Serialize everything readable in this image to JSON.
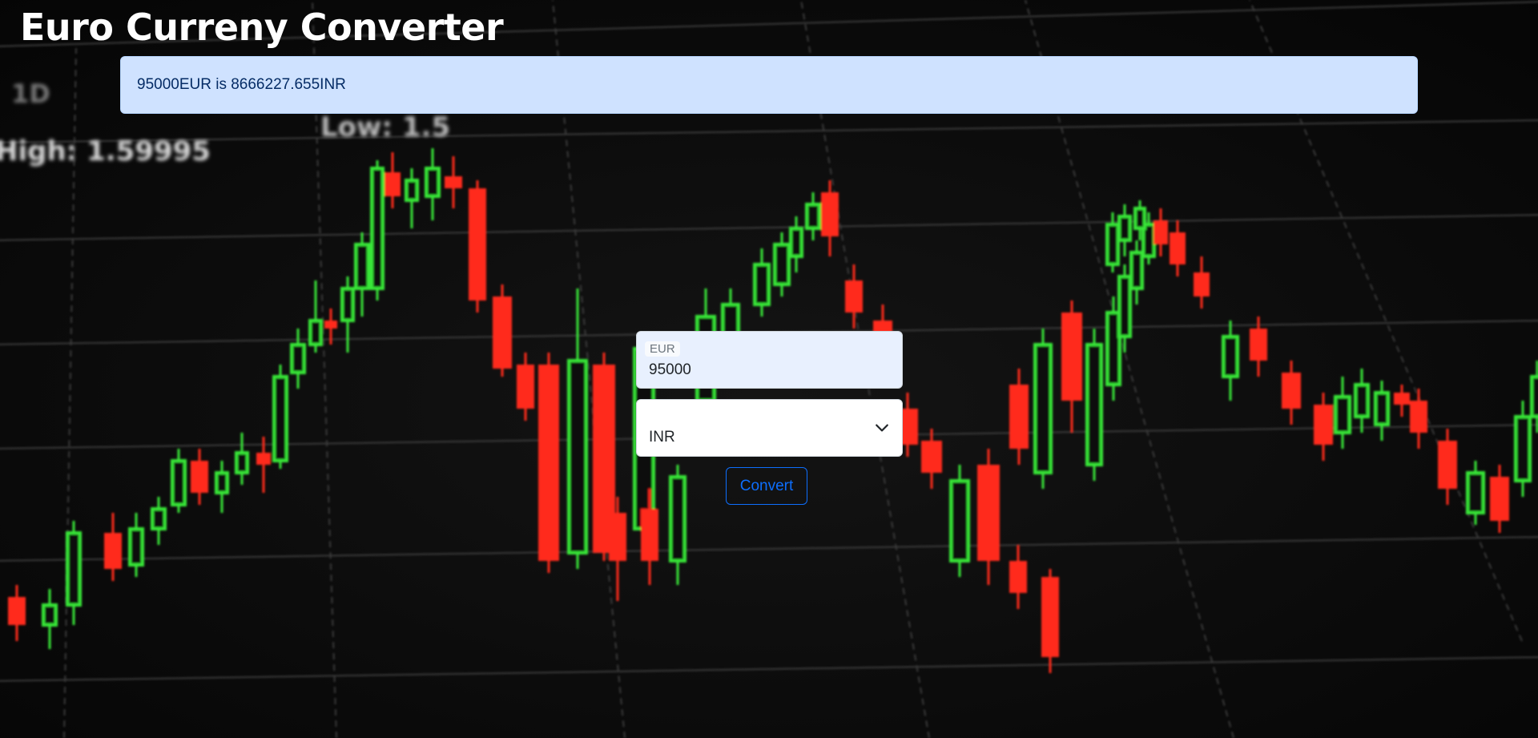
{
  "app": {
    "title": "Euro Curreny Converter"
  },
  "result": {
    "text": "95000EUR is 8666227.655INR"
  },
  "form": {
    "amount_label": "EUR",
    "amount_value": "95000",
    "target_currency": "INR",
    "convert_label": "Convert"
  },
  "background": {
    "chart_labels": {
      "high": "High: 1.59995",
      "low": "Low: 1.5",
      "period": "1D"
    }
  },
  "colors": {
    "alert_bg": "#cfe2ff",
    "alert_text": "#052c65",
    "primary": "#0d6efd",
    "candle_up": "#39e639",
    "candle_down": "#ff2a1a"
  }
}
